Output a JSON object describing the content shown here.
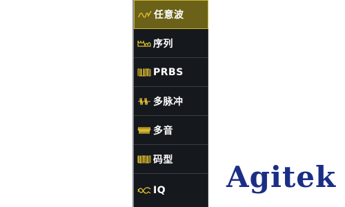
{
  "menu": {
    "items": [
      {
        "label": "任意波",
        "icon": "arbitrary-wave-icon",
        "selected": true
      },
      {
        "label": "序列",
        "icon": "sequence-icon",
        "selected": false
      },
      {
        "label": "PRBS",
        "icon": "prbs-icon",
        "selected": false
      },
      {
        "label": "多脉冲",
        "icon": "multi-pulse-icon",
        "selected": false
      },
      {
        "label": "多音",
        "icon": "multi-tone-icon",
        "selected": false
      },
      {
        "label": "码型",
        "icon": "pattern-icon",
        "selected": false
      },
      {
        "label": "IQ",
        "icon": "iq-icon",
        "selected": false
      }
    ]
  },
  "logo": {
    "text": "Agitek"
  },
  "colors": {
    "menu_background": "#15181d",
    "selected_background": "#6b6118",
    "selected_border": "#c9b832",
    "icon_color": "#e0c030",
    "logo_color": "#1b2e86"
  }
}
